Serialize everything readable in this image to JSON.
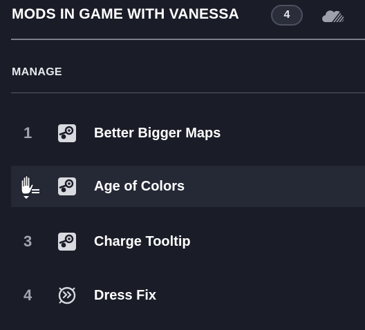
{
  "header": {
    "title": "MODS IN GAME WITH VANESSA",
    "count": "4",
    "cloud_icon": "cloud-sync-icon"
  },
  "section": {
    "label": "MANAGE"
  },
  "mods": [
    {
      "index": "1",
      "name": "Better Bigger Maps",
      "source_icon": "steam-icon"
    },
    {
      "index": "",
      "name": "Age of Colors",
      "source_icon": "steam-icon",
      "state": "hovered-drag"
    },
    {
      "index": "3",
      "name": "Charge Tooltip",
      "source_icon": "steam-icon"
    },
    {
      "index": "4",
      "name": "Dress Fix",
      "source_icon": "paradox-icon"
    }
  ],
  "colors": {
    "background": "#1a1c27",
    "row_highlight": "#252835",
    "badge_border": "#4d5061",
    "index_text": "#a2a4b0"
  }
}
